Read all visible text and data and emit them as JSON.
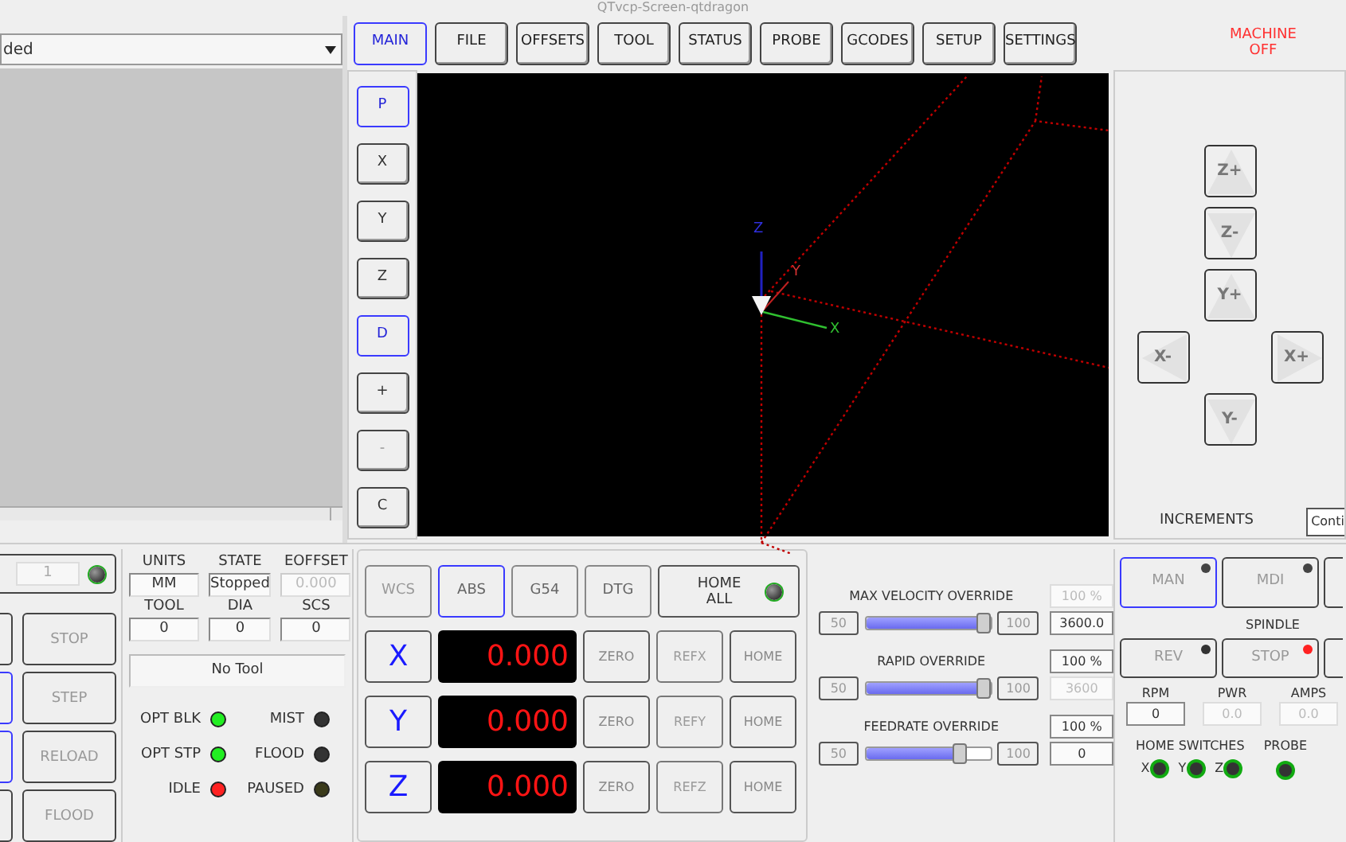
{
  "window": {
    "title": "QTvcp-Screen-qtdragon"
  },
  "file_dropdown": {
    "value": "ded"
  },
  "tabs": [
    {
      "label": "MAIN",
      "selected": true
    },
    {
      "label": "FILE",
      "selected": false
    },
    {
      "label": "OFFSETS",
      "selected": false
    },
    {
      "label": "TOOL",
      "selected": false
    },
    {
      "label": "STATUS",
      "selected": false
    },
    {
      "label": "PROBE",
      "selected": false
    },
    {
      "label": "GCODES",
      "selected": false
    },
    {
      "label": "SETUP",
      "selected": false
    },
    {
      "label": "SETTINGS",
      "selected": false
    }
  ],
  "machine_status": "MACHINE OFF",
  "view_buttons": [
    {
      "label": "P",
      "selected": true,
      "disabled": false
    },
    {
      "label": "X",
      "selected": false,
      "disabled": false
    },
    {
      "label": "Y",
      "selected": false,
      "disabled": false
    },
    {
      "label": "Z",
      "selected": false,
      "disabled": false
    },
    {
      "label": "D",
      "selected": true,
      "disabled": false
    },
    {
      "label": "+",
      "selected": false,
      "disabled": false
    },
    {
      "label": "-",
      "selected": false,
      "disabled": true
    },
    {
      "label": "C",
      "selected": false,
      "disabled": false
    }
  ],
  "viewer": {
    "axis_labels": [
      "Z",
      "Y",
      "X"
    ]
  },
  "jog_buttons": [
    {
      "label": "Z+",
      "kind": "up"
    },
    {
      "label": "Z-",
      "kind": "down"
    },
    {
      "label": "Y+",
      "kind": "up"
    },
    {
      "label": "X-",
      "kind": "left"
    },
    {
      "label": "X+",
      "kind": "right"
    },
    {
      "label": "Y-",
      "kind": "down"
    }
  ],
  "increments": {
    "label": "INCREMENTS",
    "value": "Conti"
  },
  "program_controls": {
    "line_field": "1",
    "buttons": [
      {
        "label": "STOP"
      },
      {
        "label": "STEP"
      },
      {
        "label": "RELOAD"
      },
      {
        "label": "FLOOD"
      }
    ]
  },
  "status": {
    "fields": [
      {
        "label": "UNITS",
        "value": "MM",
        "disabled": false
      },
      {
        "label": "STATE",
        "value": "Stopped",
        "disabled": false
      },
      {
        "label": "EOFFSET",
        "value": "0.000",
        "disabled": true
      },
      {
        "label": "TOOL",
        "value": "0",
        "disabled": false
      },
      {
        "label": "DIA",
        "value": "0",
        "disabled": false
      },
      {
        "label": "SCS",
        "value": "0",
        "disabled": false
      }
    ],
    "tool_description": "No Tool",
    "indicators": [
      {
        "label": "OPT BLK",
        "color": "#22ee22"
      },
      {
        "label": "MIST",
        "color": "#333333"
      },
      {
        "label": "OPT STP",
        "color": "#22ee22"
      },
      {
        "label": "FLOOD",
        "color": "#333333"
      },
      {
        "label": "IDLE",
        "color": "#ff2222"
      },
      {
        "label": "PAUSED",
        "color": "#3a3a1a"
      }
    ]
  },
  "dro": {
    "mode_buttons": [
      {
        "label": "WCS",
        "selected": false,
        "disabled": true
      },
      {
        "label": "ABS",
        "selected": true,
        "disabled": false
      },
      {
        "label": "G54",
        "selected": false,
        "disabled": false
      },
      {
        "label": "DTG",
        "selected": false,
        "disabled": false
      }
    ],
    "home_all": "HOME ALL",
    "axes": [
      {
        "axis": "X",
        "value": "0.000",
        "zero": "ZERO",
        "ref": "REFX",
        "home": "HOME"
      },
      {
        "axis": "Y",
        "value": "0.000",
        "zero": "ZERO",
        "ref": "REFY",
        "home": "HOME"
      },
      {
        "axis": "Z",
        "value": "0.000",
        "zero": "ZERO",
        "ref": "REFZ",
        "home": "HOME"
      }
    ]
  },
  "overrides": [
    {
      "label": "MAX VELOCITY OVERRIDE",
      "min": "50",
      "max": "100",
      "level": 1.0,
      "percent": "100 %",
      "percent_disabled": true,
      "value": "3600.0",
      "value_disabled": false
    },
    {
      "label": "RAPID OVERRIDE",
      "min": "50",
      "max": "100",
      "level": 1.0,
      "percent": "100 %",
      "percent_disabled": false,
      "value": "3600",
      "value_disabled": true
    },
    {
      "label": "FEEDRATE OVERRIDE",
      "min": "50",
      "max": "100",
      "level": 0.8,
      "percent": "100 %",
      "percent_disabled": false,
      "value": "0",
      "value_disabled": false
    }
  ],
  "modes": [
    {
      "label": "MAN",
      "selected": true
    },
    {
      "label": "MDI",
      "selected": false
    }
  ],
  "spindle": {
    "label": "SPINDLE",
    "buttons": [
      {
        "label": "REV",
        "color": "#333333"
      },
      {
        "label": "STOP",
        "color": "#ff2222"
      }
    ],
    "readouts": [
      {
        "label": "RPM",
        "value": "0",
        "disabled": false
      },
      {
        "label": "PWR",
        "value": "0.0",
        "disabled": true
      },
      {
        "label": "AMPS",
        "value": "0.0",
        "disabled": true
      }
    ]
  },
  "home_switches": {
    "label": "HOME SWITCHES",
    "switches": [
      "X",
      "Y",
      "Z"
    ]
  },
  "probe": {
    "label": "PROBE"
  }
}
